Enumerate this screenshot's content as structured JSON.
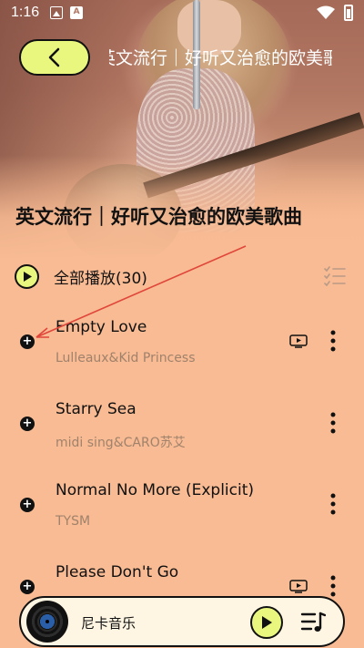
{
  "status_bar": {
    "time": "1:16",
    "icons": [
      "image-icon",
      "a-notification-icon",
      "wifi-icon",
      "battery-icon"
    ]
  },
  "header": {
    "back_icon": "chevron-left-icon",
    "title": "英文流行｜好听又治愈的欧美歌"
  },
  "playlist": {
    "title": "英文流行｜好听又治愈的欧美歌曲",
    "play_all_label": "全部播放(30)",
    "multiselect_icon": "list-check-icon"
  },
  "songs": [
    {
      "title": "Empty Love",
      "artist": "Lulleaux&Kid Princess",
      "has_mv": true
    },
    {
      "title": "Starry Sea",
      "artist": "midi sing&CARO苏艾",
      "has_mv": false
    },
    {
      "title": "Normal No More (Explicit)",
      "artist": "TYSM",
      "has_mv": false
    },
    {
      "title": "Please Don't Go",
      "artist": "",
      "has_mv": true
    }
  ],
  "mini_player": {
    "title": "尼卡音乐",
    "play_icon": "play-icon",
    "playlist_icon": "playlist-icon"
  },
  "colors": {
    "background": "#F8BB93",
    "accent": "#E9F77E",
    "artist_text": "#A0826C",
    "annotation_arrow": "#E0463A"
  }
}
